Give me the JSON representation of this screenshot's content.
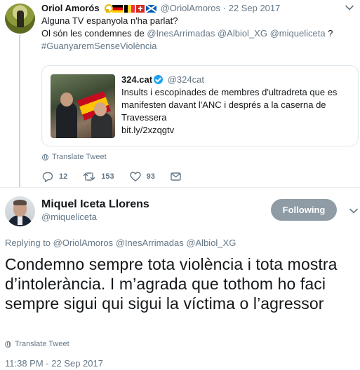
{
  "parent_tweet": {
    "name": "Oriol Amorós",
    "handle": "@OriolAmoros",
    "separator": "·",
    "date": "22 Sep 2017",
    "line1": "Alguna TV espanyola n'ha parlat?",
    "line2_prefix": "Ol són les condemnes de ",
    "mention1": "@InesArrimadas",
    "mention2": "@Albiol_XG",
    "mention3": "@miqueliceta",
    "line2_suffix": " ?",
    "hashtag": "#GuanyaremSenseViolència",
    "quoted": {
      "name": "324.cat",
      "handle": "@324cat",
      "text_line1": "Insults i escopinades de membres  d'ultradreta que es",
      "text_line2": "manifesten davant l'ANC i després a la caserna de",
      "text_line3": "Travessera",
      "link": "bit.ly/2xzqgtv"
    },
    "translate_label": "Translate Tweet",
    "actions": {
      "replies": "12",
      "retweets": "153",
      "likes": "93"
    }
  },
  "main_tweet": {
    "name": "Miquel Iceta Llorens",
    "handle": "@miqueliceta",
    "follow_label": "Following",
    "replying_prefix": "Replying to ",
    "replying_to": "@OriolAmoros @InesArrimadas @Albiol_XG",
    "text": "Condemno sempre tota violència i tota mostra d’intolerància. I m’agrada que tothom ho faci sempre sigui qui sigui la víctima o l’agressor",
    "translate_label": "Translate Tweet",
    "timestamp": "11:38 PM - 22 Sep 2017"
  },
  "colors": {
    "text": "#14171a",
    "muted": "#657786",
    "verified": "#1da1f2",
    "following_button": "#8f9ca6",
    "border": "#e1e8ed"
  },
  "icons": [
    "yellow-ribbon-icon",
    "flag-germany-icon",
    "flag-belgium-icon",
    "flag-switzerland-icon",
    "flag-scotland-icon",
    "verified-icon",
    "globe-icon",
    "reply-icon",
    "retweet-icon",
    "like-icon",
    "message-icon",
    "chevron-down-icon"
  ]
}
